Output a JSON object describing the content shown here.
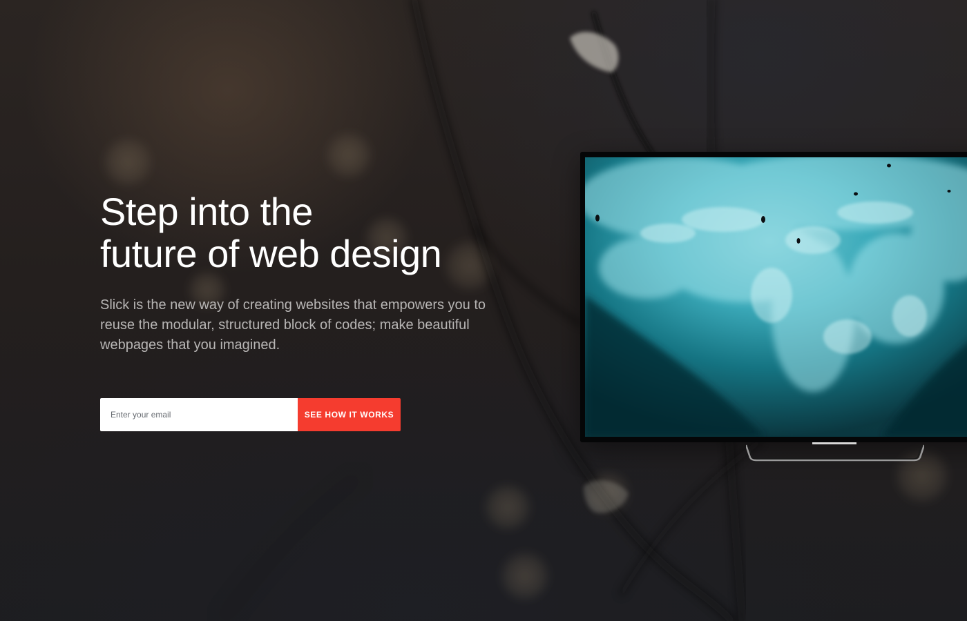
{
  "hero": {
    "headline_line1": "Step into the",
    "headline_line2": "future of web design",
    "description": "Slick is the new way of creating websites that empowers you to reuse the modular, structured block of codes; make beautiful webpages that you imagined."
  },
  "signup": {
    "email_placeholder": "Enter your email",
    "cta_label": "SEE HOW IT WORKS"
  },
  "colors": {
    "accent": "#f53c2f",
    "background": "#1f1d1e",
    "text_primary": "#ffffff",
    "text_secondary": "#b8b6b5"
  },
  "icons": {
    "tv": "television-mockup"
  }
}
